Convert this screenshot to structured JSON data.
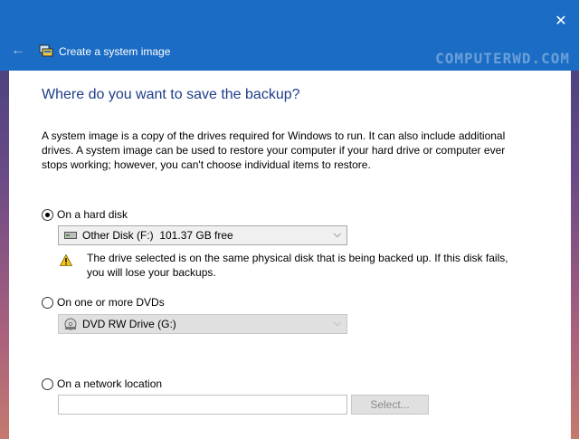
{
  "window": {
    "title": "Create a system image",
    "close_glyph": "✕",
    "back_glyph": "←",
    "accent_color": "#1a6cc4"
  },
  "watermark": "COMPUTERWD.COM",
  "heading": "Where do you want to save the backup?",
  "description": "A system image is a copy of the drives required for Windows to run. It can also include additional drives. A system image can be used to restore your computer if your hard drive or computer ever stops working; however, you can't choose individual items to restore.",
  "options": {
    "hard_disk": {
      "label": "On a hard disk",
      "checked": true,
      "selected_value": "Other Disk (F:)  101.37 GB free",
      "icon": "hard-drive-icon",
      "warning": "The drive selected is on the same physical disk that is being backed up. If this disk fails, you will lose your backups."
    },
    "dvd": {
      "label": "On one or more DVDs",
      "checked": false,
      "selected_value": "DVD RW Drive (G:)",
      "icon": "dvd-drive-icon"
    },
    "network": {
      "label": "On a network location",
      "checked": false,
      "input_value": "",
      "select_label": "Select..."
    }
  },
  "combo_arrow_glyph": "⌵"
}
